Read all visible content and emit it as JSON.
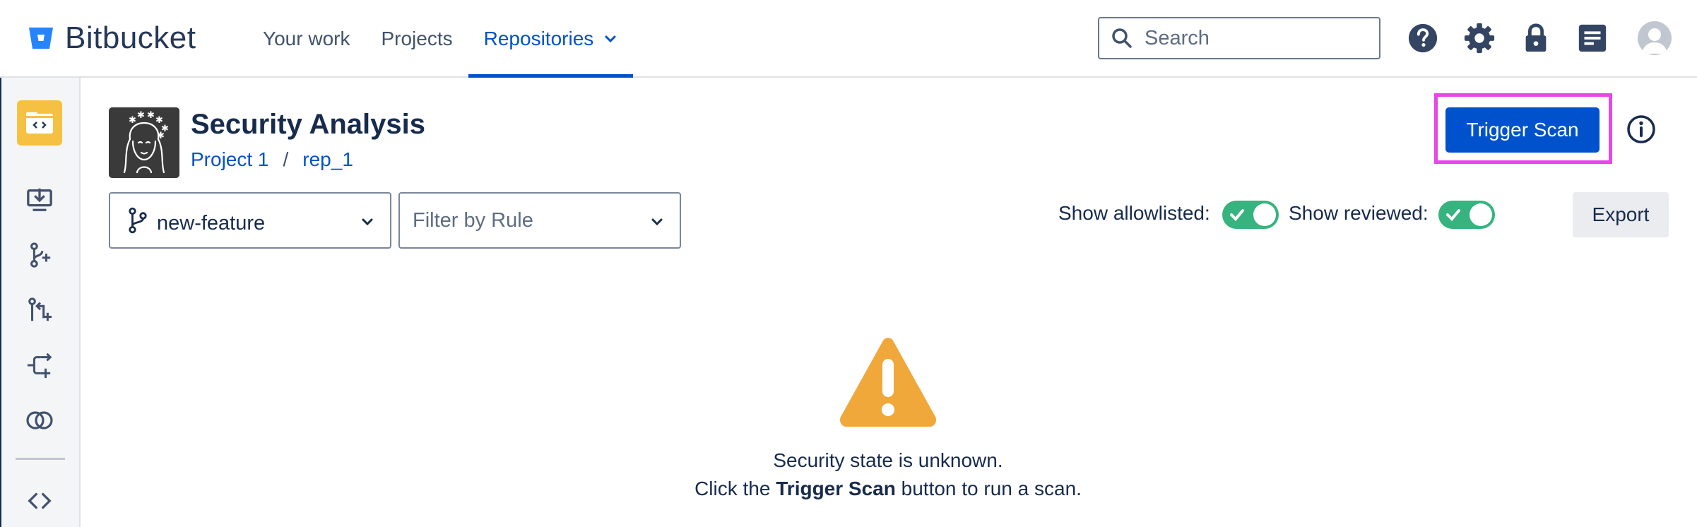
{
  "brand": {
    "name": "Bitbucket",
    "logo_icon": "bitbucket-logo-icon",
    "color": "#2684FF"
  },
  "nav": {
    "items": [
      {
        "label": "Your work"
      },
      {
        "label": "Projects"
      },
      {
        "label": "Repositories",
        "active": true,
        "icon": "chevron-down-icon"
      }
    ]
  },
  "search": {
    "placeholder": "Search",
    "value": ""
  },
  "top_icons": [
    "help-icon",
    "settings-icon",
    "lock-icon",
    "notes-icon"
  ],
  "sidebar": {
    "repo_icon": "repository-icon",
    "items": [
      "clone-icon",
      "branch-create-icon",
      "pull-request-create-icon",
      "fork-icon",
      "compare-icon",
      "source-icon"
    ]
  },
  "header": {
    "title": "Security Analysis",
    "breadcrumb": {
      "project": "Project 1",
      "separator": "/",
      "repo": "rep_1"
    }
  },
  "actions": {
    "trigger_scan": "Trigger Scan",
    "export": "Export",
    "info_icon": "info-icon"
  },
  "filters": {
    "branch": {
      "value": "new-feature",
      "icon": "branch-icon"
    },
    "rule": {
      "placeholder": "Filter by Rule"
    }
  },
  "toggles": {
    "allowlisted": {
      "label": "Show allowlisted:",
      "on": true
    },
    "reviewed": {
      "label": "Show reviewed:",
      "on": true
    }
  },
  "empty_state": {
    "icon": "warning-icon",
    "line1": "Security state is unknown.",
    "line2_prefix": "Click the",
    "line2_strong": "Trigger Scan",
    "line2_suffix": "button to run a scan."
  },
  "colors": {
    "primary": "#0052CC",
    "toggle_on": "#36B37E",
    "warning": "#F0A83A",
    "highlight": "#E946E9"
  }
}
